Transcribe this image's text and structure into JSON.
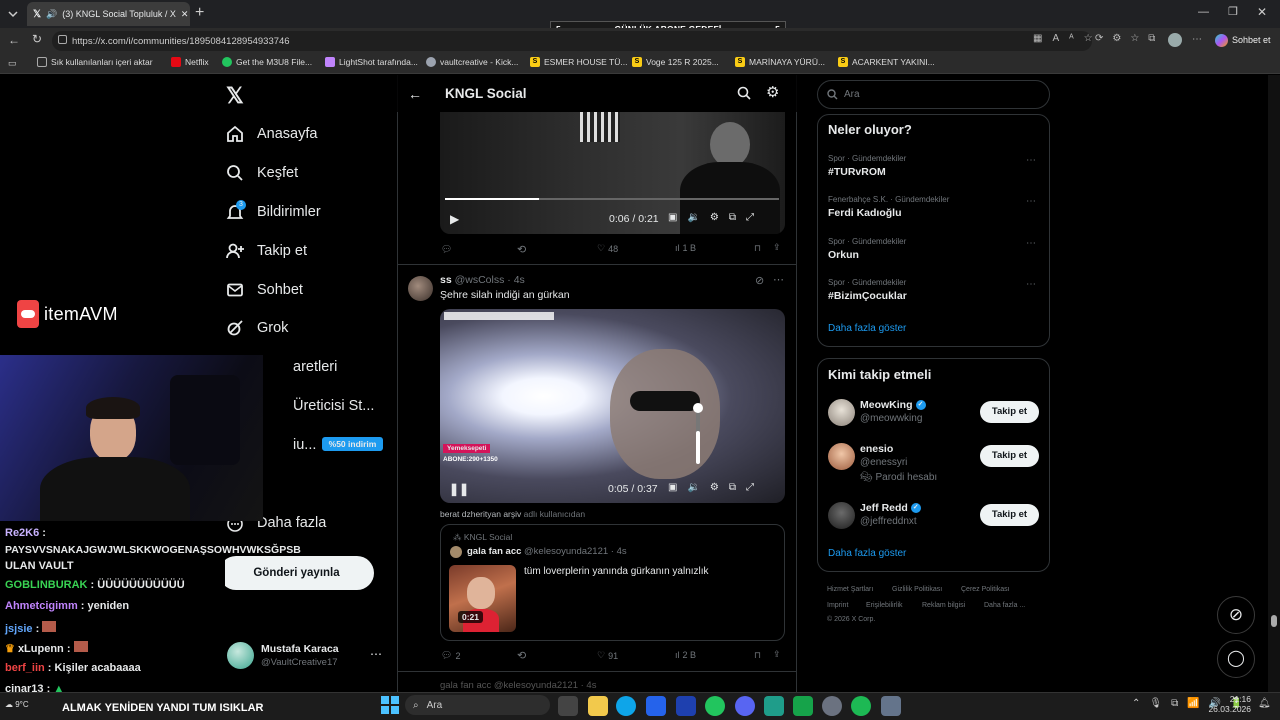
{
  "browser": {
    "tab_title": "(3) KNGL Social Topluluk / X",
    "url": "https://x.com/i/communities/1895084128954933746",
    "profile_label": "Sohbet et",
    "bookmarks": [
      "Sık kullanılanları içeri aktar",
      "Netflix",
      "Get the M3U8 File...",
      "LightShot tarafında...",
      "vaultcreative - Kick...",
      "ESMER HOUSE TÜ...",
      "Voge 125 R 2025...",
      "MARİNAYA YÜRÜ...",
      "ACARKENT YAKINI..."
    ]
  },
  "overlay": {
    "goal_left": "5",
    "goal_title": "GÜNLÜK ABONE GEDEFİ",
    "goal_right": "5",
    "sponsor": "itemAVM",
    "bottom_ticker": "ALMAK YENİDEN YANDI TUM ISIKLAR",
    "weather": "9°C"
  },
  "nav": {
    "items": [
      "Anasayfa",
      "Keşfet",
      "Bildirimler",
      "Takip et",
      "Sohbet",
      "Grok",
      "aretleri",
      "Üreticisi St...",
      "iu...",
      "Daha fazla"
    ],
    "badge_count": "3",
    "discount_badge": "%50 indirim",
    "post_button": "Gönderi yayınla",
    "user_name": "Mustafa Karaca",
    "user_handle": "@VaultCreative17"
  },
  "feed": {
    "title": "KNGL Social",
    "post1": {
      "video_time": "0:06 / 0:21",
      "replies": "",
      "reposts": "",
      "likes": "48",
      "views": "1 B"
    },
    "post2": {
      "author": "ss",
      "handle": "@wsColss",
      "time": "4s",
      "text": "Şehre silah indiği an gürkan",
      "video_time": "0:05 / 0:37",
      "video_overlay": "Yemeksepeti",
      "video_sub": "ABONE:290+1350",
      "volume_level": 0.55,
      "removed_note_user": "berat dzherityan arşiv",
      "removed_note": "adlı kullanıcıdan",
      "quote": {
        "community": "KNGL Social",
        "author": "gala fan acc",
        "handle": "@kelesoyunda2121",
        "time": "4s",
        "text": "tüm loverplerin yanında gürkanın yalnızlık",
        "thumb_time": "0:21"
      },
      "replies": "2",
      "reposts": "",
      "likes": "91",
      "views": "2 B"
    },
    "post3_peek": "gala fan acc @kelesoyunda2121 · 4s"
  },
  "right": {
    "search_placeholder": "Ara",
    "trends_title": "Neler oluyor?",
    "trends": [
      {
        "cat": "Spor · Gündemdekiler",
        "title": "#TURvROM"
      },
      {
        "cat": "Fenerbahçe S.K. · Gündemdekiler",
        "title": "Ferdi Kadıoğlu"
      },
      {
        "cat": "Spor · Gündemdekiler",
        "title": "Orkun"
      },
      {
        "cat": "Spor · Gündemdekiler",
        "title": "#BizimÇocuklar"
      }
    ],
    "show_more": "Daha fazla göster",
    "follow_title": "Kimi takip etmeli",
    "follow": [
      {
        "name": "MeowKing",
        "handle": "@meowwking",
        "extra": ""
      },
      {
        "name": "enesio",
        "handle": "@enessyri",
        "extra": "Parodi hesabı"
      },
      {
        "name": "Jeff Redd",
        "handle": "@jeffreddnxt",
        "extra": ""
      }
    ],
    "follow_btn": "Takip et",
    "footer": [
      "Hizmet Şartları",
      "Gizlilik Politikası",
      "Çerez Politikası",
      "Imprint",
      "Erişilebilirlik",
      "Reklam bilgisi",
      "Daha fazla ...",
      "© 2026 X Corp."
    ]
  },
  "chat": [
    {
      "user": "Re2K6",
      "text": "",
      "color": "#c9b3ff"
    },
    {
      "user": "",
      "text": "PAYSVVSNAKAJGWJWLSKKWOGENAŞSOWHVWKSĞPSB",
      "color": "#ffffff"
    },
    {
      "user": "",
      "text": "ULAN VAULT",
      "color": "#ffffff"
    },
    {
      "user": "GOBLINBURAK",
      "text": "ÜÜÜÜÜÜÜÜÜÜÜ",
      "color": "#39d353"
    },
    {
      "user": "Ahmetcigimm",
      "text": "yeniden",
      "color": "#c084fc"
    },
    {
      "user": "jsjsie",
      "text": "",
      "color": "#60a5fa"
    },
    {
      "user": "xLupenn",
      "text": "",
      "color": "#ffffff"
    },
    {
      "user": "berf_iin",
      "text": "Kişiler acabaaaa",
      "color": "#ef4444"
    },
    {
      "user": "cinar13",
      "text": "",
      "color": "#ffffff"
    }
  ],
  "taskbar": {
    "search": "Ara",
    "time": "21:16",
    "date": "26.03.2026"
  }
}
